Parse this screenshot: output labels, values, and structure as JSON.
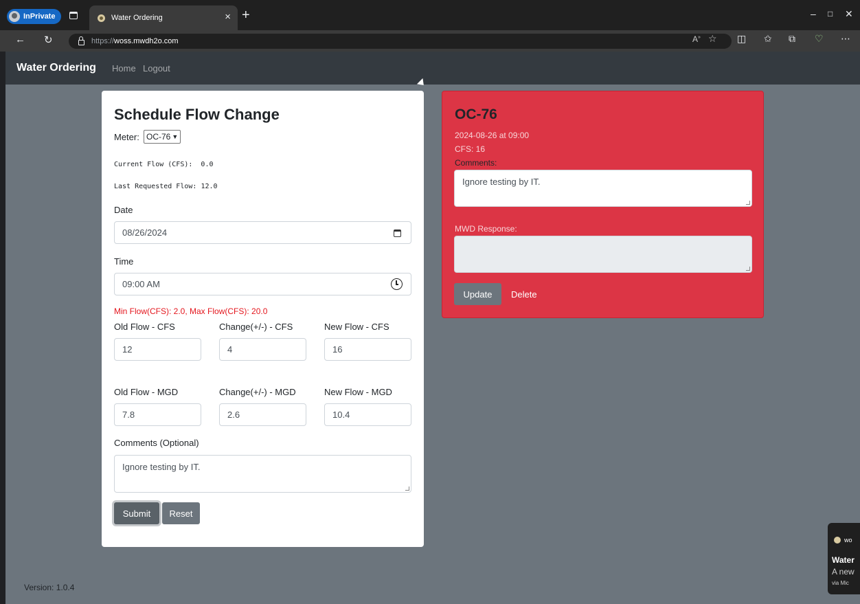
{
  "browser": {
    "profile_label": "InPrivate",
    "tab_title": "Water Ordering",
    "url_prefix": "https://",
    "url_host": "woss.mwdh2o.com"
  },
  "nav": {
    "brand": "Water Ordering",
    "links": [
      "Home",
      "Logout"
    ]
  },
  "form": {
    "title": "Schedule Flow Change",
    "meter_label": "Meter:",
    "meter_value": "OC-76",
    "current_flow_label": "Current Flow (CFS):",
    "current_flow_value": "0.0",
    "last_requested_label": "Last Requested Flow:",
    "last_requested_value": "12.0",
    "date_label": "Date",
    "date_value": "08/26/2024",
    "time_label": "Time",
    "time_value": "09:00 AM",
    "min_max": "Min Flow(CFS): 2.0, Max Flow(CFS): 20.0",
    "cfs_labels": [
      "Old Flow - CFS",
      "Change(+/-) - CFS",
      "New Flow - CFS"
    ],
    "cfs_values": [
      "12",
      "4",
      "16"
    ],
    "mgd_labels": [
      "Old Flow - MGD",
      "Change(+/-) - MGD",
      "New Flow - MGD"
    ],
    "mgd_values": [
      "7.8",
      "2.6",
      "10.4"
    ],
    "comments_label": "Comments (Optional)",
    "comments_value": "Ignore testing by IT.",
    "submit_label": "Submit",
    "reset_label": "Reset"
  },
  "request_panel": {
    "meter": "OC-76",
    "datetime": "2024-08-26 at 09:00",
    "cfs": "CFS: 16",
    "comments_label": "Comments:",
    "comments_value": "Ignore testing by IT.",
    "response_label": "MWD Response:",
    "response_value": "",
    "update_label": "Update",
    "delete_label": "Delete",
    "accent_color": "#dc3545"
  },
  "footer": {
    "version": "Version: 1.0.4"
  },
  "toast": {
    "source": "wo",
    "title": "Water",
    "body": "A new",
    "via": "via Mic"
  }
}
